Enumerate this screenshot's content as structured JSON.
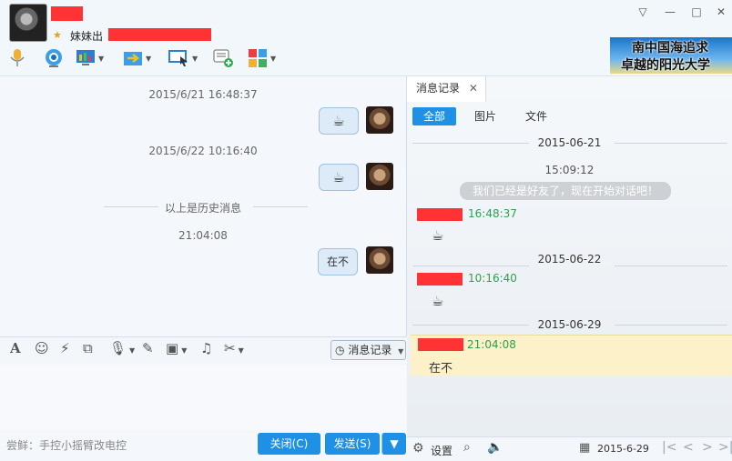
{
  "header": {
    "signature_prefix": "妹妹出",
    "window_controls": [
      "▽",
      "—",
      "□",
      "✕"
    ],
    "ad": {
      "line1": "南中国海追求",
      "line2": "卓越的阳光大学"
    }
  },
  "toolbar_icons": [
    "microphone-icon",
    "video-icon",
    "screen-share-icon",
    "file-transfer-icon",
    "remote-assist-icon",
    "add-chat-icon",
    "apps-grid-icon"
  ],
  "chat": {
    "messages": [
      {
        "time": "2015/6/21 16:48:37",
        "content": "☕"
      },
      {
        "time": "2015/6/22 10:16:40",
        "content": "☕"
      }
    ],
    "history_separator": "以上是历史消息",
    "current_time": "21:04:08",
    "current_message": "在不"
  },
  "input_toolbar": {
    "message_record_button": "消息记录"
  },
  "footer": {
    "tip": "尝鲜：手控小摇臂改电控",
    "close_button": "关闭(C)",
    "send_button": "发送(S)"
  },
  "history": {
    "tab_label": "消息记录",
    "filters": [
      "全部",
      "图片",
      "文件"
    ],
    "days": [
      {
        "date": "2015-06-21",
        "time": "15:09:12",
        "system_message": "我们已经是好友了，现在开始对话吧！",
        "msg_time": "16:48:37",
        "content": "☕"
      },
      {
        "date": "2015-06-22",
        "msg_time": "10:16:40",
        "content": "☕"
      },
      {
        "date": "2015-06-29",
        "msg_time": "21:04:08",
        "content": "在不"
      }
    ],
    "footer": {
      "settings_label": "设置",
      "date_value": "2015-6-29"
    }
  },
  "colors": {
    "accent": "#1e90e6",
    "time_green": "#2e9e4e",
    "highlight": "#fdf1c9",
    "redaction": "#ff3333"
  }
}
